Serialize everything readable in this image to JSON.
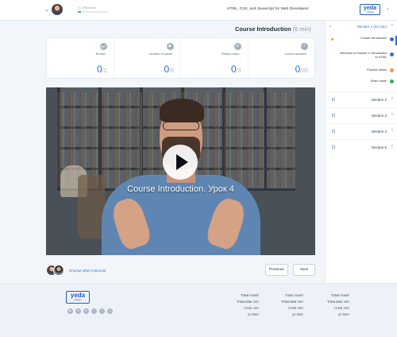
{
  "header": {
    "progress_text": "0 / 196 hours",
    "progress_fraction": 0.1,
    "course_title": "HTML, CSS, and Javascript for Web Developers",
    "logo_line1": "yeda",
    "logo_line2": "college"
  },
  "lesson": {
    "title": "Course Introduction",
    "duration": "(6 min)"
  },
  "stats": [
    {
      "label": "Breaks",
      "value": "0",
      "total": "/2",
      "icon": "coffee-icon"
    },
    {
      "label": "Number of pause",
      "value": "0",
      "total": "/5",
      "icon": "play-icon"
    },
    {
      "label": "Rewind video",
      "value": "0",
      "total": "/3",
      "icon": "rewind-icon"
    },
    {
      "label": "Correct answers",
      "value": "0",
      "total": "/20",
      "icon": "check-icon"
    }
  ],
  "video": {
    "caption": "Course Introduction. Урок 4"
  },
  "actions": {
    "choose_instructor": "Choose other instructor",
    "previous": "Previous",
    "next": "Next"
  },
  "sidebar": {
    "section1": "Section 1 (32 min)",
    "items": [
      {
        "label": "Course Introduction",
        "left_dot": "#f0a030",
        "right_dot": "#2f6fdb"
      },
      {
        "label": "Welcome to Module 1: Introduction to HTML",
        "left_dot": "",
        "right_dot": "#2f6fdb"
      },
      {
        "label": "Practice Name",
        "left_dot": "",
        "right_dot": "#f0a030"
      },
      {
        "label": "Exam name",
        "left_dot": "",
        "right_dot": "#2fb15b"
      }
    ],
    "sections": [
      "Section 2",
      "Section 3",
      "Section 4",
      "Section 5"
    ]
  },
  "footer": {
    "col1": [
      "לשוניות אשדוד",
      "רחוב שמש אשדוד",
      "רחוב ממכרז",
      "רשות רגן"
    ],
    "col2": [
      "לשוניות אשדוד",
      "רחוב שמש אשדוד",
      "רחוב ממכרז",
      "רשות רגן"
    ],
    "col3": [
      "לשוניות אשדוד",
      "רחוב שמש אשדוד",
      "רחוב ממכרז",
      "רשות רגן"
    ]
  },
  "colors": {
    "accent": "#2f6fdb",
    "progress": "#2fb15b",
    "warning": "#f0a030"
  }
}
